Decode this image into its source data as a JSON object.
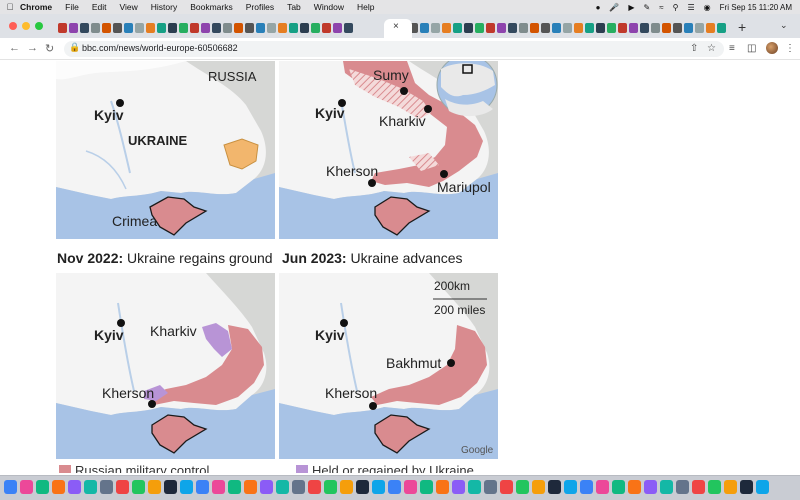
{
  "menubar": {
    "app_name": "Chrome",
    "items": [
      "File",
      "Edit",
      "View",
      "History",
      "Bookmarks",
      "Profiles",
      "Tab",
      "Window",
      "Help"
    ],
    "clock": "Fri Sep 15  11:20 AM"
  },
  "browser": {
    "url": "bbc.com/news/world-europe-60506682",
    "active_tab_close": "×",
    "new_tab": "+"
  },
  "maps": {
    "map1": {
      "country_russia": "RUSSIA",
      "country_ukraine": "UKRAINE",
      "city_kyiv": "Kyiv",
      "region_crimea": "Crimea"
    },
    "map2": {
      "city_sumy": "Sumy",
      "city_kyiv": "Kyiv",
      "city_kharkiv": "Kharkiv",
      "city_kherson": "Kherson",
      "city_mariupol": "Mariupol"
    },
    "map3": {
      "caption_date": "Nov 2022:",
      "caption_text": " Ukraine regains ground",
      "city_kyiv": "Kyiv",
      "city_kharkiv": "Kharkiv",
      "city_kherson": "Kherson"
    },
    "map4": {
      "caption_date": "Jun 2023:",
      "caption_text": " Ukraine advances",
      "city_kyiv": "Kyiv",
      "city_bakhmut": "Bakhmut",
      "city_kherson": "Kherson",
      "scale_km": "200km",
      "scale_miles": "200 miles",
      "attribution": "Google"
    }
  },
  "legend": {
    "russian_control": "Russian military control",
    "ukraine_regained": "Held or regained by Ukraine"
  },
  "colors": {
    "russian_control": "#d98b8f",
    "ukraine_regained": "#b894d6",
    "pre_war_occupied": "#f2b66d",
    "sea": "#a8c3e6",
    "land": "#f4f4f4",
    "russia_land": "#d6d7d5"
  }
}
